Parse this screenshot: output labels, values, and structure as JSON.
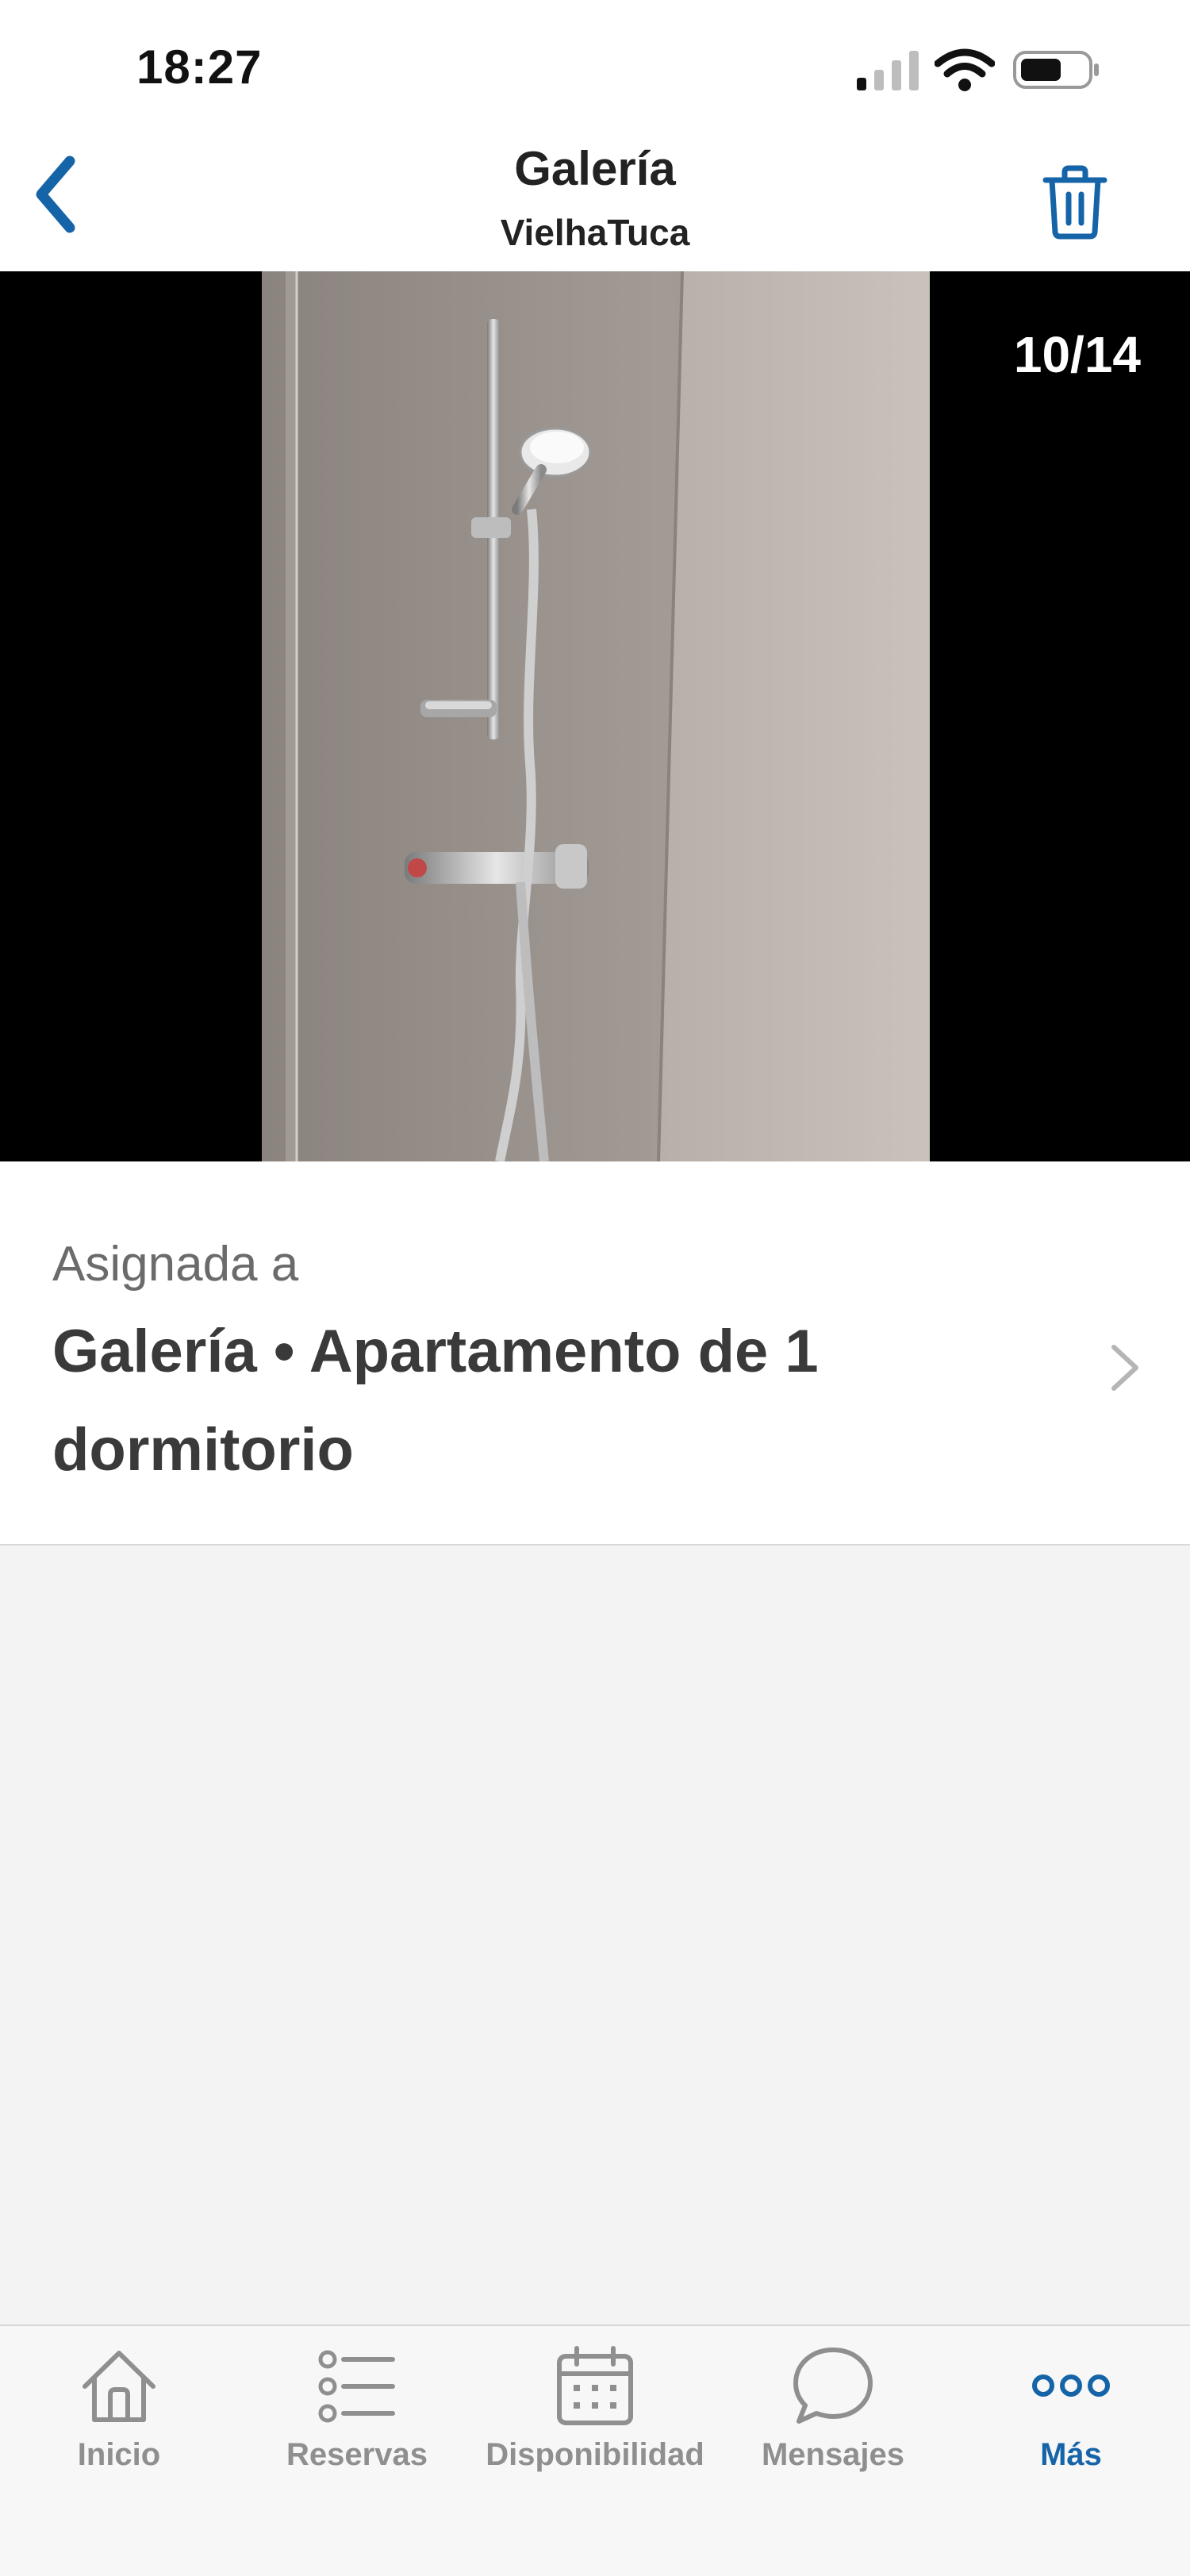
{
  "status_bar": {
    "time": "18:27"
  },
  "header": {
    "title": "Galería",
    "subtitle": "VielhaTuca"
  },
  "gallery": {
    "counter": "10/14"
  },
  "assigned": {
    "label": "Asignada a",
    "value": "Galería • Apartamento de 1 dormitorio"
  },
  "tabbar": {
    "items": [
      {
        "label": "Inicio",
        "icon": "home-icon",
        "active": false
      },
      {
        "label": "Reservas",
        "icon": "list-icon",
        "active": false
      },
      {
        "label": "Disponibilidad",
        "icon": "calendar-icon",
        "active": false
      },
      {
        "label": "Mensajes",
        "icon": "chat-bubble-icon",
        "active": false
      },
      {
        "label": "Más",
        "icon": "more-dots-icon",
        "active": true
      }
    ]
  },
  "colors": {
    "accent": "#1664a8",
    "inactive_tab": "#8f8f8f",
    "background": "#f3f3f3"
  }
}
